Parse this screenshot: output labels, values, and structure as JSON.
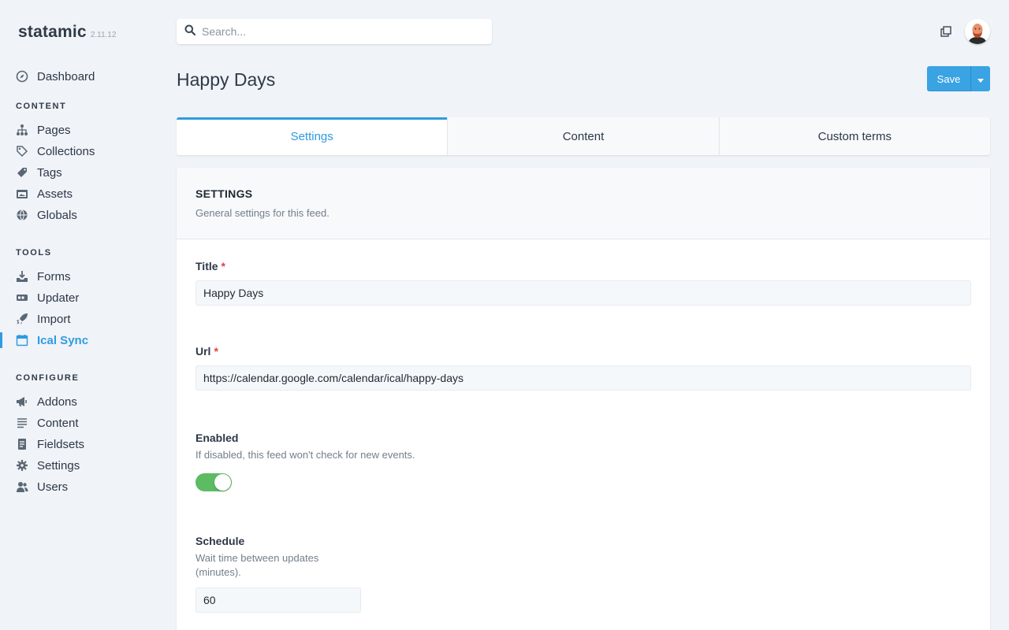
{
  "brand": {
    "name": "statamic",
    "version": "2.11.12"
  },
  "sidebar": {
    "dashboard": "Dashboard",
    "sections": {
      "content": "CONTENT",
      "tools": "TOOLS",
      "configure": "CONFIGURE"
    },
    "content_items": [
      {
        "label": "Pages",
        "icon": "sitemap-icon"
      },
      {
        "label": "Collections",
        "icon": "tags-icon"
      },
      {
        "label": "Tags",
        "icon": "tag-icon"
      },
      {
        "label": "Assets",
        "icon": "folder-image-icon"
      },
      {
        "label": "Globals",
        "icon": "globe-icon"
      }
    ],
    "tools_items": [
      {
        "label": "Forms",
        "icon": "download-tray-icon"
      },
      {
        "label": "Updater",
        "icon": "updater-icon"
      },
      {
        "label": "Import",
        "icon": "rocket-icon"
      },
      {
        "label": "Ical Sync",
        "icon": "calendar-icon",
        "active": true
      }
    ],
    "configure_items": [
      {
        "label": "Addons",
        "icon": "megaphone-icon"
      },
      {
        "label": "Content",
        "icon": "lines-icon"
      },
      {
        "label": "Fieldsets",
        "icon": "document-icon"
      },
      {
        "label": "Settings",
        "icon": "gear-icon"
      },
      {
        "label": "Users",
        "icon": "users-icon"
      }
    ]
  },
  "search": {
    "placeholder": "Search..."
  },
  "header": {
    "title": "Happy Days",
    "save_label": "Save"
  },
  "tabs": [
    {
      "label": "Settings",
      "active": true
    },
    {
      "label": "Content",
      "active": false
    },
    {
      "label": "Custom terms",
      "active": false
    }
  ],
  "section": {
    "title": "SETTINGS",
    "description": "General settings for this feed."
  },
  "fields": {
    "title": {
      "label": "Title",
      "required_mark": "*",
      "value": "Happy Days"
    },
    "url": {
      "label": "Url",
      "required_mark": "*",
      "value": "https://calendar.google.com/calendar/ical/happy-days"
    },
    "enabled": {
      "label": "Enabled",
      "help": "If disabled, this feed won't check for new events.",
      "value": true
    },
    "schedule": {
      "label": "Schedule",
      "help_line1": "Wait time between updates",
      "help_line2": "(minutes).",
      "value": "60"
    }
  },
  "colors": {
    "accent": "#2f9be0",
    "toggle_on": "#5dbb63",
    "required": "#e53e3e"
  }
}
